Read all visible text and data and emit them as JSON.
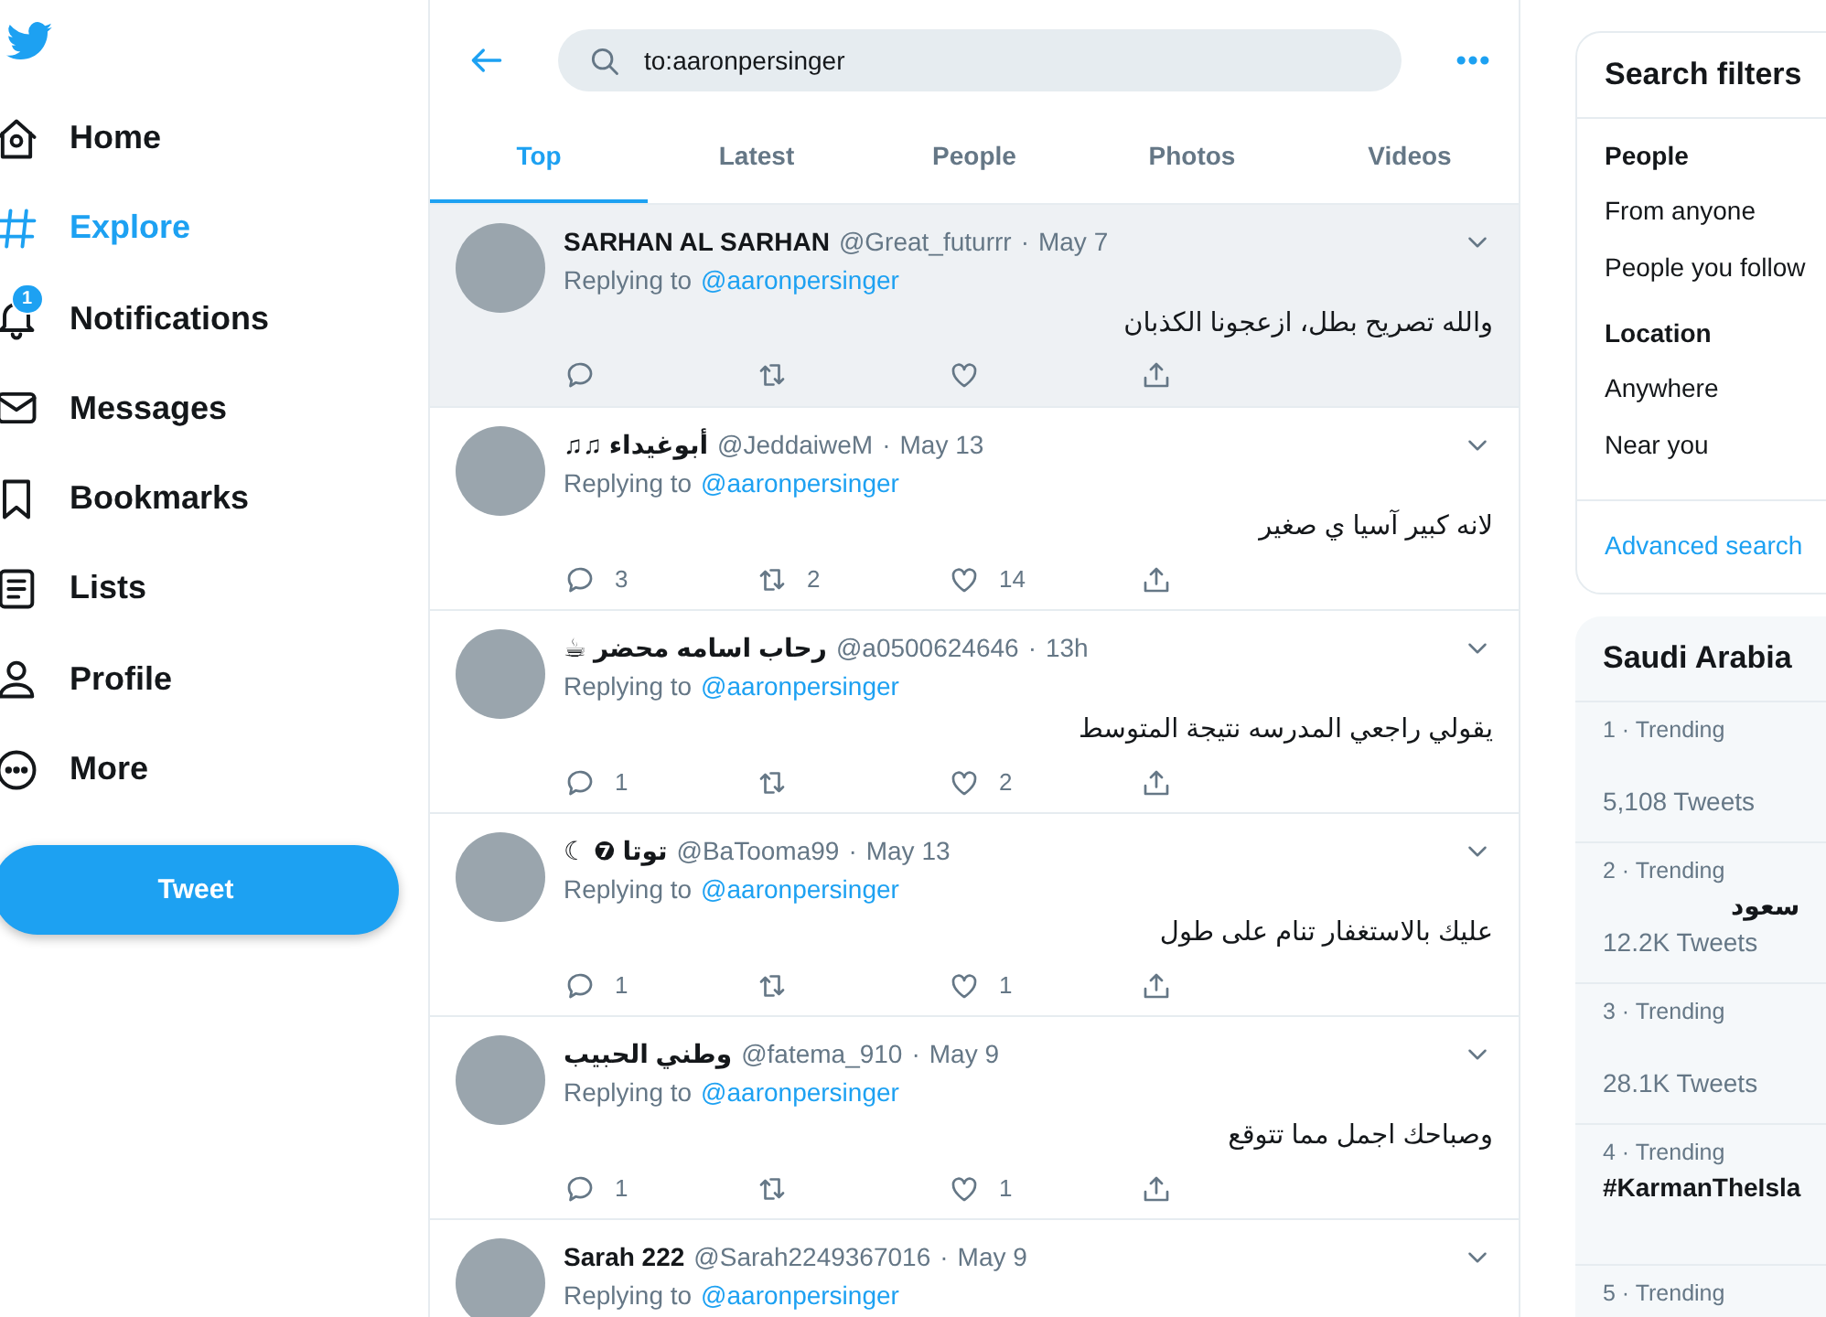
{
  "nav": {
    "items": [
      {
        "kind": "home",
        "label": "Home",
        "selected": false
      },
      {
        "kind": "explore",
        "label": "Explore",
        "selected": true
      },
      {
        "kind": "bell",
        "label": "Notifications",
        "selected": false,
        "badge": "1"
      },
      {
        "kind": "mail",
        "label": "Messages",
        "selected": false
      },
      {
        "kind": "bookmark",
        "label": "Bookmarks",
        "selected": false
      },
      {
        "kind": "list",
        "label": "Lists",
        "selected": false
      },
      {
        "kind": "person",
        "label": "Profile",
        "selected": false
      },
      {
        "kind": "more",
        "label": "More",
        "selected": false
      }
    ],
    "tweet_button": "Tweet"
  },
  "search": {
    "value": "to:aaronpersinger"
  },
  "tabs": [
    {
      "label": "Top",
      "selected": true
    },
    {
      "label": "Latest",
      "selected": false
    },
    {
      "label": "People",
      "selected": false
    },
    {
      "label": "Photos",
      "selected": false
    },
    {
      "label": "Videos",
      "selected": false
    }
  ],
  "tweets": [
    {
      "name": "SARHAN AL SARHAN",
      "handle": "@Great_futurrr",
      "dot": "·",
      "date": "May 7",
      "replying": "Replying to",
      "reply_to": "@aaronpersinger",
      "text": "والله تصريح بطل، ازعجونا الكذبان",
      "hovered": true
    },
    {
      "name": "♫♫ أبوغيداء",
      "handle": "@JeddaiweM",
      "dot": "·",
      "date": "May 13",
      "replying": "Replying to",
      "reply_to": "@aaronpersinger",
      "text": "لانه كبير آسيا ي صغير",
      "replies": "3",
      "retweets": "2",
      "likes": "14",
      "hovered": false
    },
    {
      "name": "☕ رحاب اسامه محضر",
      "handle": "@a0500624646",
      "dot": "·",
      "date": "13h",
      "replying": "Replying to",
      "reply_to": "@aaronpersinger",
      "text": "يقولي راجعي المدرسه نتيجة المتوسط",
      "replies": "1",
      "likes": "2",
      "hovered": false
    },
    {
      "name": "☾ ❼ توتا",
      "handle": "@BaTooma99",
      "dot": "·",
      "date": "May 13",
      "replying": "Replying to",
      "reply_to": "@aaronpersinger",
      "text": "عليك بالاستغفار تنام على طول",
      "replies": "1",
      "likes": "1",
      "hovered": false
    },
    {
      "name": "وطني الحبيب",
      "handle": "@fatema_910",
      "dot": "·",
      "date": "May 9",
      "replying": "Replying to",
      "reply_to": "@aaronpersinger",
      "text": "وصباحك  اجمل  مما تتوقع",
      "replies": "1",
      "likes": "1",
      "hovered": false
    },
    {
      "name": "Sarah 222",
      "handle": "@Sarah2249367016",
      "dot": "·",
      "date": "May 9",
      "replying": "Replying to",
      "reply_to": "@aaronpersinger",
      "hovered": false
    }
  ],
  "filters": {
    "title": "Search filters",
    "groups": [
      {
        "heading": "People",
        "options": [
          "From anyone",
          "People you follow"
        ]
      },
      {
        "heading": "Location",
        "options": [
          "Anywhere",
          "Near you"
        ]
      }
    ],
    "link": "Advanced search"
  },
  "trends": {
    "title": "Saudi Arabia",
    "items": [
      {
        "meta": "1 · Trending",
        "count": "5,108 Tweets"
      },
      {
        "meta": "2 · Trending",
        "topic": "سعود",
        "count": "12.2K Tweets"
      },
      {
        "meta": "3 · Trending",
        "count": "28.1K Tweets"
      },
      {
        "meta": "4 · Trending",
        "topic": "#KarmanTheIsla"
      },
      {
        "meta": "5 · Trending"
      }
    ]
  }
}
